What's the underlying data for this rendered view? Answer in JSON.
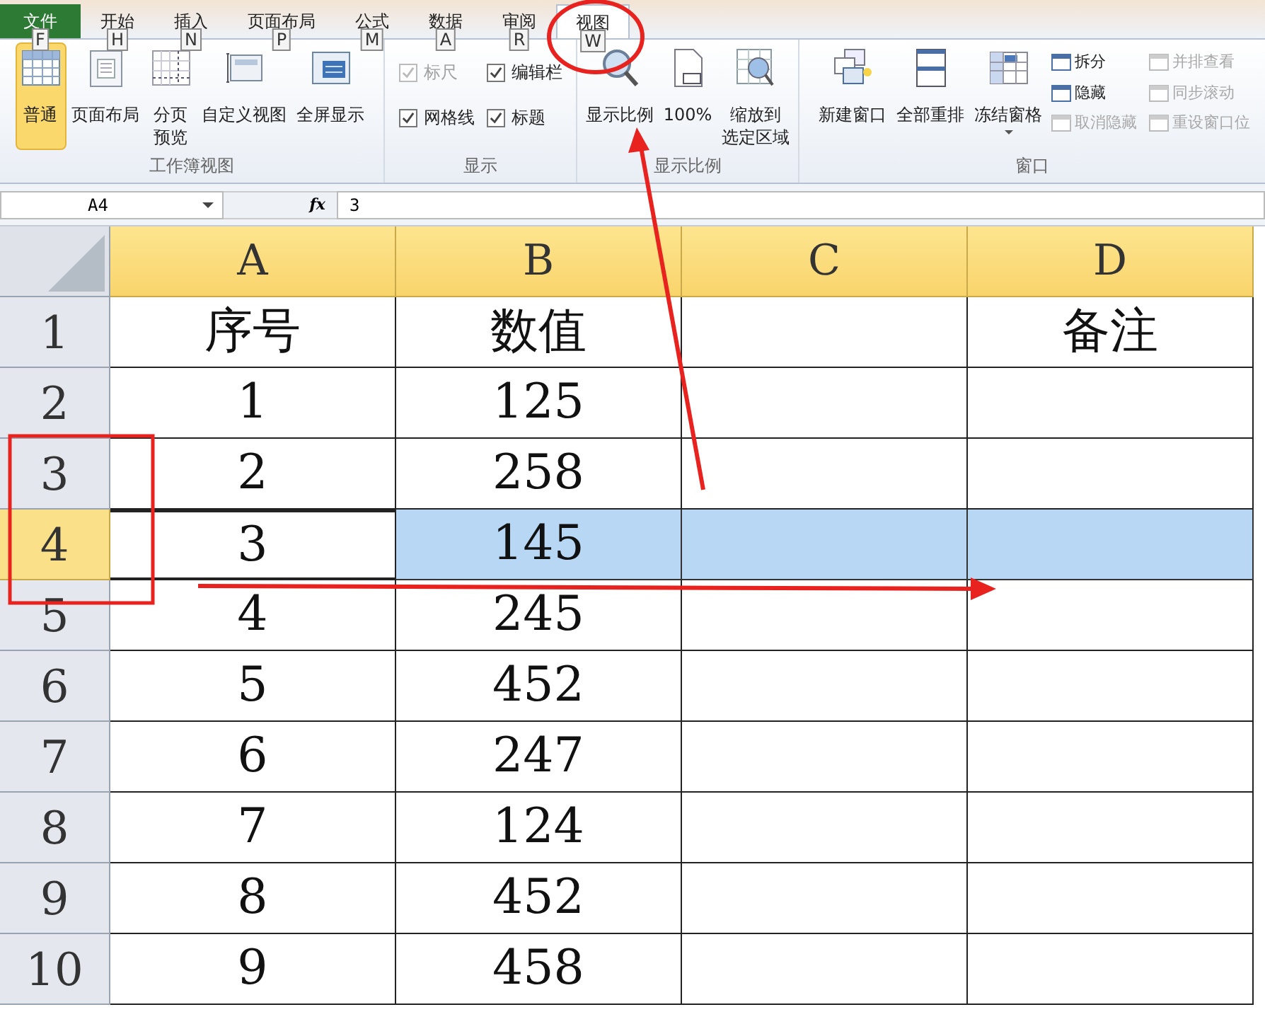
{
  "file_tab": {
    "label": "文件",
    "keytip": "F"
  },
  "tabs": [
    {
      "label": "开始",
      "keytip": "H",
      "selected": false
    },
    {
      "label": "插入",
      "keytip": "N",
      "selected": false
    },
    {
      "label": "页面布局",
      "keytip": "P",
      "selected": false
    },
    {
      "label": "公式",
      "keytip": "M",
      "selected": false
    },
    {
      "label": "数据",
      "keytip": "A",
      "selected": false
    },
    {
      "label": "审阅",
      "keytip": "R",
      "selected": false
    },
    {
      "label": "视图",
      "keytip": "W",
      "selected": true
    }
  ],
  "ribbon": {
    "groups": [
      {
        "title": "工作簿视图",
        "items": [
          {
            "kind": "big",
            "lines": [
              "普通"
            ],
            "selected": true
          },
          {
            "kind": "big",
            "lines": [
              "页面布局"
            ],
            "selected": false
          },
          {
            "kind": "big",
            "lines": [
              "分页",
              "预览"
            ],
            "selected": false
          },
          {
            "kind": "big",
            "lines": [
              "自定义视图"
            ],
            "selected": false
          },
          {
            "kind": "big",
            "lines": [
              "全屏显示"
            ],
            "selected": false
          }
        ]
      },
      {
        "title": "显示",
        "items": [
          {
            "kind": "check",
            "label": "标尺",
            "checked": true,
            "disabled": true
          },
          {
            "kind": "check",
            "label": "编辑栏",
            "checked": true,
            "disabled": false
          },
          {
            "kind": "check",
            "label": "网格线",
            "checked": true,
            "disabled": false
          },
          {
            "kind": "check",
            "label": "标题",
            "checked": true,
            "disabled": false
          }
        ]
      },
      {
        "title": "显示比例",
        "items": [
          {
            "kind": "big",
            "lines": [
              "显示比例"
            ],
            "selected": false
          },
          {
            "kind": "big",
            "lines": [
              "100%"
            ],
            "selected": false
          },
          {
            "kind": "big",
            "lines": [
              "缩放到",
              "选定区域"
            ],
            "selected": false
          }
        ]
      },
      {
        "title": "窗口",
        "items": [
          {
            "kind": "big",
            "lines": [
              "新建窗口"
            ],
            "selected": false
          },
          {
            "kind": "big",
            "lines": [
              "全部重排"
            ],
            "selected": false
          },
          {
            "kind": "big",
            "lines": [
              "冻结窗格"
            ],
            "selected": false,
            "dropdown": true
          },
          {
            "kind": "small",
            "label": "拆分",
            "disabled": false
          },
          {
            "kind": "small",
            "label": "隐藏",
            "disabled": false
          },
          {
            "kind": "small",
            "label": "取消隐藏",
            "disabled": true
          },
          {
            "kind": "small",
            "label": "并排查看",
            "disabled": true
          },
          {
            "kind": "small",
            "label": "同步滚动",
            "disabled": true
          },
          {
            "kind": "small",
            "label": "重设窗口位",
            "disabled": true
          }
        ]
      }
    ]
  },
  "formula_bar": {
    "name_box": "A4",
    "fx": "fx",
    "value": "3"
  },
  "columns": [
    {
      "label": "A",
      "highlighted": true
    },
    {
      "label": "B",
      "highlighted": true
    },
    {
      "label": "C",
      "highlighted": true
    },
    {
      "label": "D",
      "highlighted": true
    }
  ],
  "rows": [
    {
      "header": "1",
      "selected": false,
      "col_a": "序号",
      "col_b": "数值",
      "col_d": "备注"
    },
    {
      "header": "2",
      "selected": false,
      "col_a": "1",
      "col_b": "125"
    },
    {
      "header": "3",
      "selected": false,
      "col_a": "2",
      "col_b": "258"
    },
    {
      "header": "4",
      "selected": true,
      "col_a": "3",
      "col_b": "145"
    },
    {
      "header": "5",
      "selected": false,
      "col_a": "4",
      "col_b": "245"
    },
    {
      "header": "6",
      "selected": false,
      "col_a": "5",
      "col_b": "452"
    },
    {
      "header": "7",
      "selected": false,
      "col_a": "6",
      "col_b": "247"
    },
    {
      "header": "8",
      "selected": false,
      "col_a": "7",
      "col_b": "124"
    },
    {
      "header": "9",
      "selected": false,
      "col_a": "8",
      "col_b": "452"
    },
    {
      "header": "10",
      "selected": false,
      "col_a": "9",
      "col_b": "458"
    }
  ]
}
